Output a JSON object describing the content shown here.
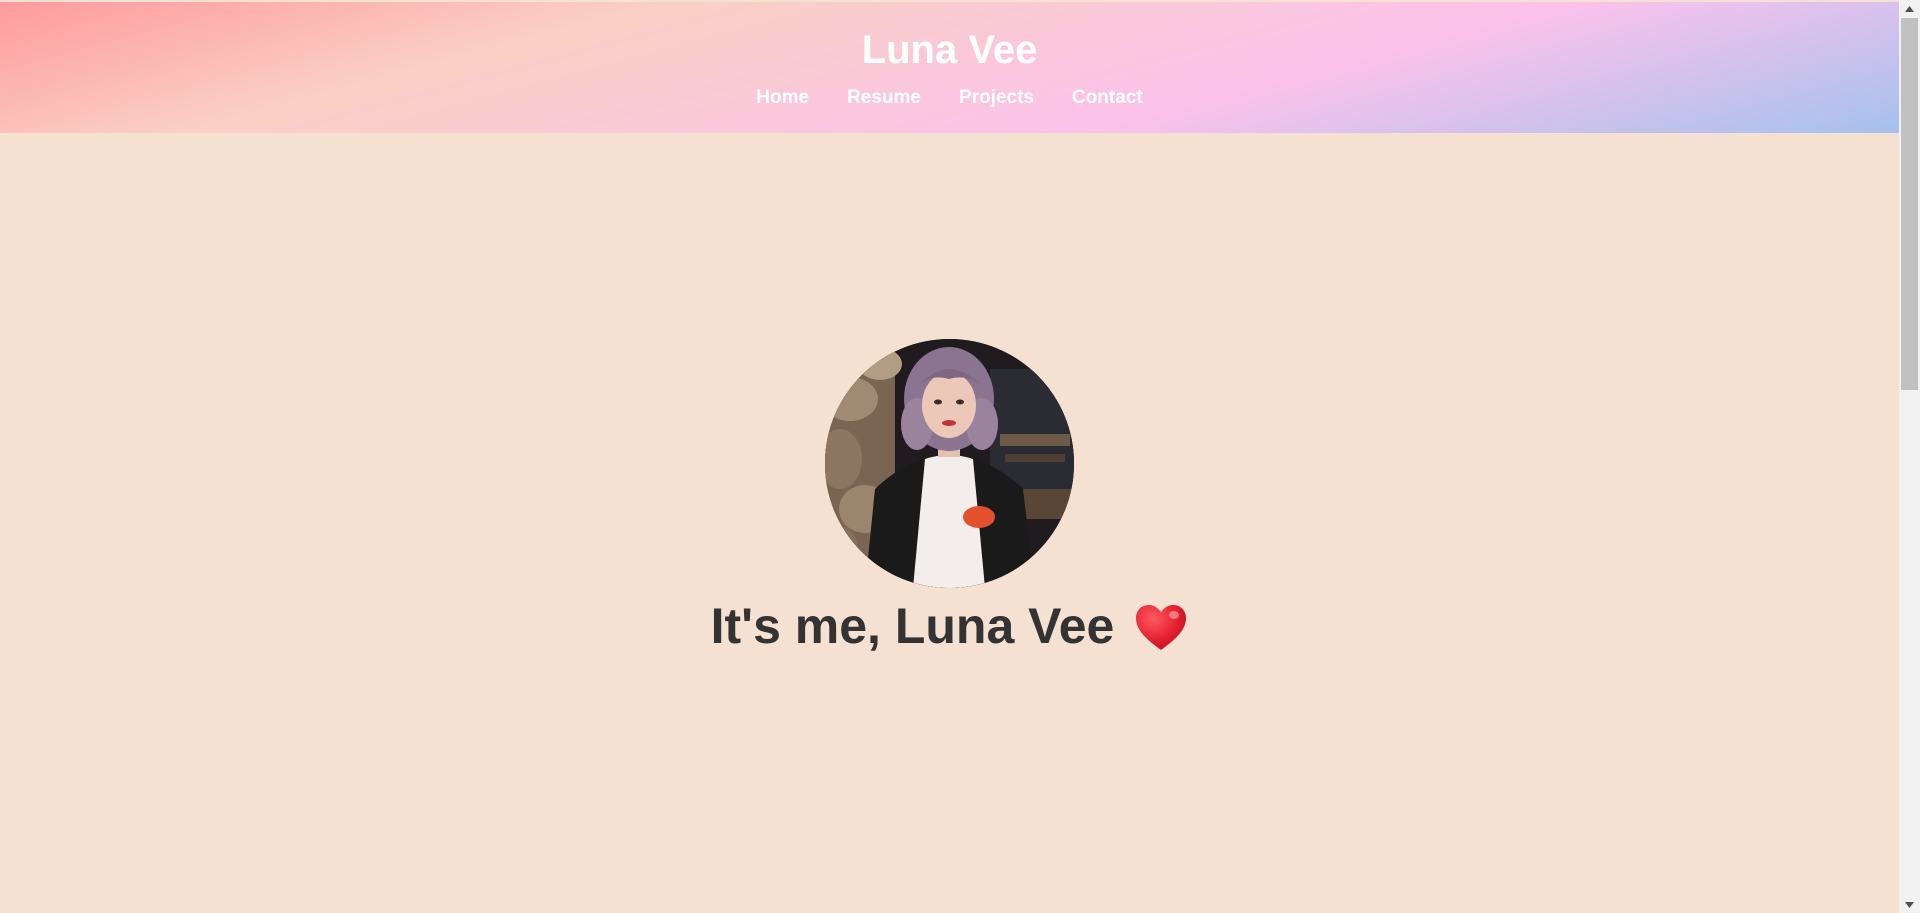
{
  "header": {
    "title": "Luna Vee",
    "nav": [
      {
        "label": "Home"
      },
      {
        "label": "Resume"
      },
      {
        "label": "Projects"
      },
      {
        "label": "Contact"
      }
    ]
  },
  "hero": {
    "heading": "It's me, Luna Vee",
    "heart_icon": "heart-icon",
    "photo_icon": "profile-photo"
  },
  "scrollbar": {
    "up_icon": "arrow-up-icon",
    "down_icon": "arrow-down-icon"
  }
}
